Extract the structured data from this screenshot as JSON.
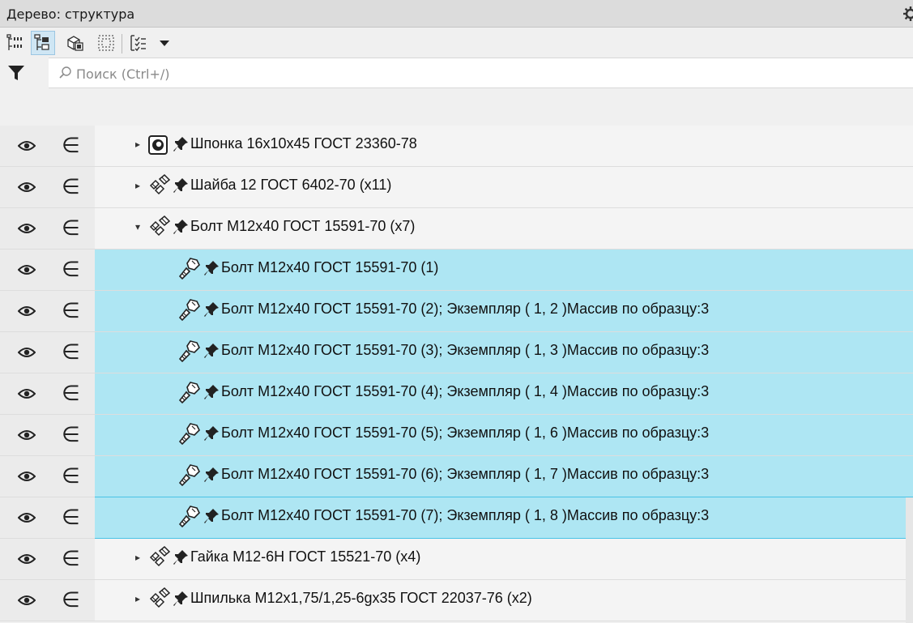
{
  "panel": {
    "title": "Дерево: структура"
  },
  "toolbar": {
    "buttons": [
      {
        "name": "tree-view-flat-icon",
        "active": false
      },
      {
        "name": "tree-view-structure-icon",
        "active": true
      },
      {
        "name": "tree-view-3d-icon",
        "active": false
      },
      {
        "name": "tree-select-icon",
        "active": false
      },
      {
        "name": "tree-filter-list-icon",
        "active": false
      },
      {
        "name": "dropdown-arrow-icon",
        "active": false
      }
    ]
  },
  "search": {
    "placeholder": "Поиск (Ctrl+/)",
    "value": ""
  },
  "tree": {
    "rows": [
      {
        "label": "Шпонка 16х10х45 ГОСТ 23360-78",
        "level": 1,
        "expander": "collapsed",
        "icon": "key-part-icon",
        "selected": false
      },
      {
        "label": "Шайба 12 ГОСТ 6402-70 (x11)",
        "level": 1,
        "expander": "collapsed",
        "icon": "standard-parts-icon",
        "selected": false
      },
      {
        "label": "Болт М12х40 ГОСТ 15591-70 (x7)",
        "level": 1,
        "expander": "expanded",
        "icon": "standard-parts-icon",
        "selected": false
      },
      {
        "label": "Болт М12х40 ГОСТ 15591-70 (1)",
        "level": 2,
        "expander": "none",
        "icon": "bolt-part-icon",
        "selected": true
      },
      {
        "label": "Болт М12х40 ГОСТ 15591-70 (2); Экземпляр ( 1, 2 )Массив по образцу:3",
        "level": 2,
        "expander": "none",
        "icon": "bolt-part-icon",
        "selected": true
      },
      {
        "label": "Болт М12х40 ГОСТ 15591-70 (3); Экземпляр ( 1, 3 )Массив по образцу:3",
        "level": 2,
        "expander": "none",
        "icon": "bolt-part-icon",
        "selected": true
      },
      {
        "label": "Болт М12х40 ГОСТ 15591-70 (4); Экземпляр ( 1, 4 )Массив по образцу:3",
        "level": 2,
        "expander": "none",
        "icon": "bolt-part-icon",
        "selected": true
      },
      {
        "label": "Болт М12х40 ГОСТ 15591-70 (5); Экземпляр ( 1, 6 )Массив по образцу:3",
        "level": 2,
        "expander": "none",
        "icon": "bolt-part-icon",
        "selected": true
      },
      {
        "label": "Болт М12х40 ГОСТ 15591-70 (6); Экземпляр ( 1, 7 )Массив по образцу:3",
        "level": 2,
        "expander": "none",
        "icon": "bolt-part-icon",
        "selected": true
      },
      {
        "label": "Болт М12х40 ГОСТ 15591-70 (7); Экземпляр ( 1, 8 )Массив по образцу:3",
        "level": 2,
        "expander": "none",
        "icon": "bolt-part-icon",
        "selected": true
      },
      {
        "label": "Гайка М12-6Н ГОСТ 15521-70 (x4)",
        "level": 1,
        "expander": "collapsed",
        "icon": "standard-parts-icon",
        "selected": false
      },
      {
        "label": "Шпилька М12х1,75/1,25-6gх35 ГОСТ 22037-76 (x2)",
        "level": 1,
        "expander": "collapsed",
        "icon": "standard-parts-icon",
        "selected": false
      }
    ],
    "member_symbol": "∈",
    "expand_collapsed": "▸",
    "expand_expanded": "▾"
  },
  "colors": {
    "selection": "#aee6f3",
    "selection_border": "#49c3e6",
    "row_bg": "#f4f4f4",
    "gutter_bg": "#ebebeb"
  }
}
